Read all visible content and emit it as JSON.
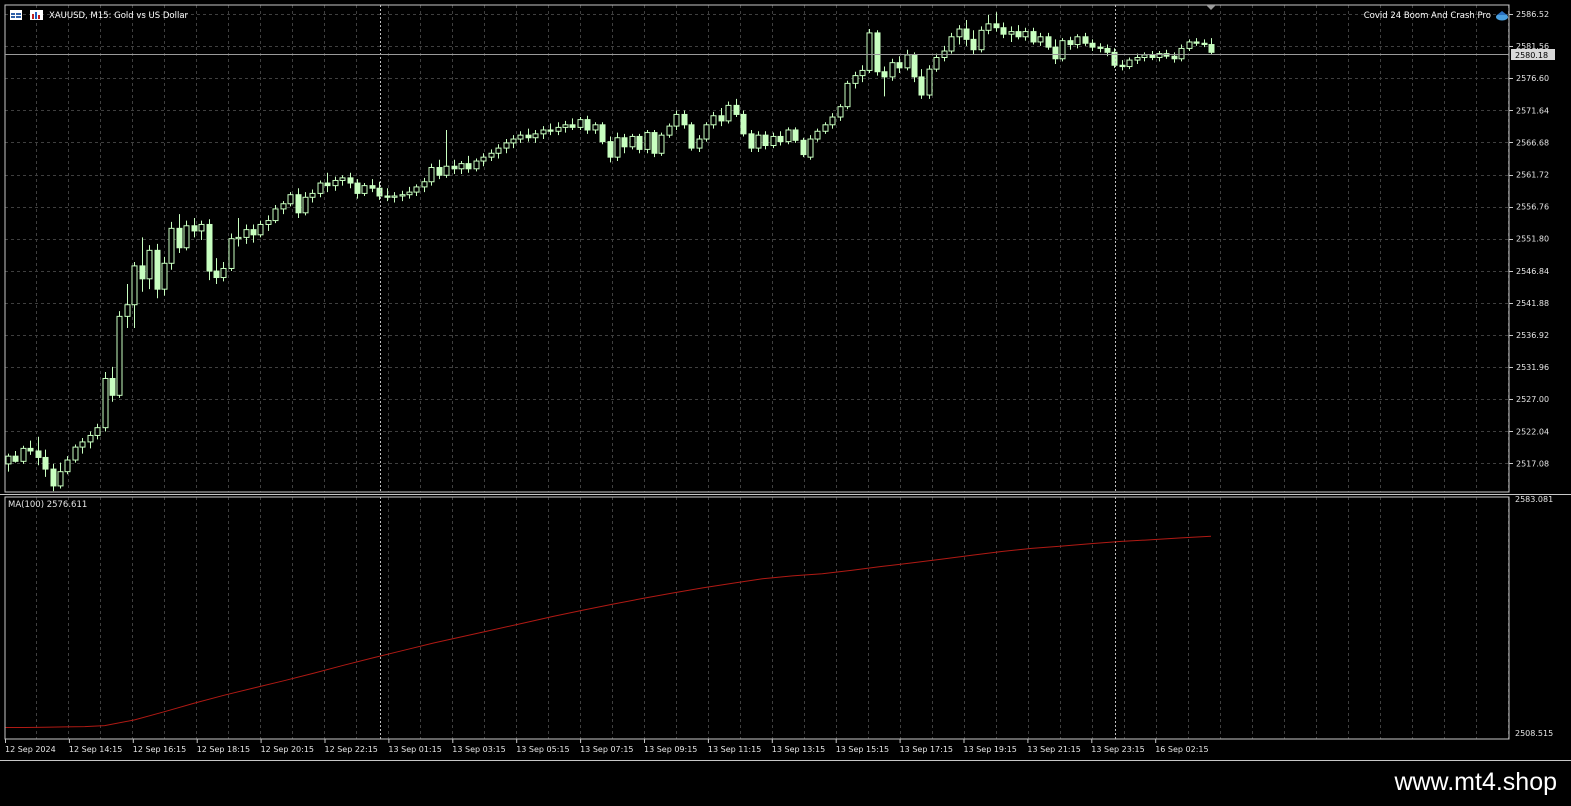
{
  "header": {
    "symbol_title": "XAUUSD, M15:  Gold vs US Dollar",
    "indicator_name": "Covid 24 Boom And Crash Pro",
    "icons": [
      "table-icon",
      "chart-icon",
      "hat-icon",
      "scroll-marker-icon"
    ]
  },
  "price_axis": {
    "labels": [
      "2586.52",
      "2581.56",
      "2576.60",
      "2571.64",
      "2566.68",
      "2561.72",
      "2556.76",
      "2551.80",
      "2546.84",
      "2541.88",
      "2536.92",
      "2531.96",
      "2527.00",
      "2522.04",
      "2517.08"
    ],
    "current_price": "2580.18"
  },
  "indicator_pane": {
    "label": "MA(100) 2576.611",
    "axis_top": "2583.081",
    "axis_bottom": "2508.515"
  },
  "time_axis": {
    "labels": [
      "12 Sep 2024",
      "12 Sep 14:15",
      "12 Sep 16:15",
      "12 Sep 18:15",
      "12 Sep 20:15",
      "12 Sep 22:15",
      "13 Sep 01:15",
      "13 Sep 03:15",
      "13 Sep 05:15",
      "13 Sep 07:15",
      "13 Sep 09:15",
      "13 Sep 11:15",
      "13 Sep 13:15",
      "13 Sep 15:15",
      "13 Sep 17:15",
      "13 Sep 19:15",
      "13 Sep 21:15",
      "13 Sep 23:15",
      "16 Sep 02:15"
    ]
  },
  "colors": {
    "background": "#000000",
    "grid": "#3f3f3f",
    "candle": "#c8ffc0",
    "ma_line": "#b01a14",
    "axis_text": "#e6e6e6"
  },
  "chart_data": {
    "type": "candlestick",
    "timeframe": "M15",
    "price_range": [
      2513.0,
      2588.0
    ],
    "candles": [
      [
        2517.0,
        2518.6,
        2515.8,
        2518.2
      ],
      [
        2518.2,
        2519.0,
        2517.2,
        2517.4
      ],
      [
        2517.4,
        2519.8,
        2517.0,
        2519.4
      ],
      [
        2519.4,
        2520.6,
        2518.4,
        2519.0
      ],
      [
        2519.0,
        2521.2,
        2516.8,
        2518.0
      ],
      [
        2518.0,
        2519.2,
        2515.0,
        2516.2
      ],
      [
        2516.2,
        2517.0,
        2512.8,
        2513.6
      ],
      [
        2513.6,
        2517.2,
        2513.2,
        2515.8
      ],
      [
        2515.8,
        2518.2,
        2515.4,
        2517.6
      ],
      [
        2517.6,
        2520.0,
        2517.2,
        2519.6
      ],
      [
        2519.6,
        2521.0,
        2518.6,
        2520.4
      ],
      [
        2520.4,
        2522.0,
        2519.4,
        2521.4
      ],
      [
        2521.4,
        2523.2,
        2520.8,
        2522.6
      ],
      [
        2522.6,
        2531.2,
        2522.0,
        2530.2
      ],
      [
        2530.2,
        2532.0,
        2526.6,
        2527.6
      ],
      [
        2527.6,
        2540.6,
        2527.2,
        2539.8
      ],
      [
        2539.8,
        2544.8,
        2538.0,
        2541.6
      ],
      [
        2541.6,
        2548.2,
        2538.0,
        2547.6
      ],
      [
        2547.6,
        2552.0,
        2543.6,
        2545.6
      ],
      [
        2545.6,
        2550.8,
        2544.0,
        2550.0
      ],
      [
        2550.0,
        2551.0,
        2542.6,
        2544.0
      ],
      [
        2544.0,
        2549.0,
        2543.0,
        2548.0
      ],
      [
        2548.0,
        2554.4,
        2547.0,
        2553.4
      ],
      [
        2553.4,
        2555.6,
        2549.6,
        2550.4
      ],
      [
        2550.4,
        2554.6,
        2550.0,
        2553.8
      ],
      [
        2553.8,
        2555.0,
        2552.0,
        2553.0
      ],
      [
        2553.0,
        2554.6,
        2551.6,
        2554.0
      ],
      [
        2554.0,
        2554.8,
        2545.4,
        2546.8
      ],
      [
        2546.8,
        2548.8,
        2544.8,
        2545.8
      ],
      [
        2545.8,
        2548.2,
        2545.2,
        2547.2
      ],
      [
        2547.2,
        2552.6,
        2546.8,
        2551.8
      ],
      [
        2551.8,
        2555.0,
        2550.6,
        2552.0
      ],
      [
        2552.0,
        2554.0,
        2551.0,
        2553.2
      ],
      [
        2553.2,
        2554.0,
        2551.2,
        2552.4
      ],
      [
        2552.4,
        2554.6,
        2552.0,
        2554.0
      ],
      [
        2554.0,
        2555.4,
        2553.0,
        2554.6
      ],
      [
        2554.6,
        2557.0,
        2554.2,
        2556.4
      ],
      [
        2556.4,
        2557.6,
        2555.6,
        2557.2
      ],
      [
        2557.2,
        2559.0,
        2556.8,
        2558.6
      ],
      [
        2558.6,
        2559.6,
        2555.0,
        2555.8
      ],
      [
        2555.8,
        2559.0,
        2555.4,
        2558.2
      ],
      [
        2558.2,
        2559.4,
        2557.4,
        2558.8
      ],
      [
        2558.8,
        2560.8,
        2558.2,
        2560.4
      ],
      [
        2560.4,
        2562.0,
        2559.0,
        2560.0
      ],
      [
        2560.0,
        2561.4,
        2559.2,
        2560.8
      ],
      [
        2560.8,
        2561.6,
        2560.0,
        2561.2
      ],
      [
        2561.2,
        2562.0,
        2559.6,
        2560.4
      ],
      [
        2560.4,
        2561.0,
        2558.0,
        2558.8
      ],
      [
        2558.8,
        2560.4,
        2558.4,
        2560.0
      ],
      [
        2560.0,
        2561.0,
        2559.0,
        2559.6
      ],
      [
        2559.6,
        2560.6,
        2557.8,
        2558.4
      ],
      [
        2558.4,
        2559.6,
        2557.6,
        2558.2
      ],
      [
        2558.2,
        2559.0,
        2557.4,
        2558.4
      ],
      [
        2558.4,
        2559.2,
        2557.6,
        2558.6
      ],
      [
        2558.6,
        2559.8,
        2558.0,
        2559.0
      ],
      [
        2559.0,
        2560.2,
        2558.4,
        2559.8
      ],
      [
        2559.8,
        2561.2,
        2559.0,
        2560.6
      ],
      [
        2560.6,
        2563.4,
        2560.0,
        2562.8
      ],
      [
        2562.8,
        2564.0,
        2561.0,
        2561.6
      ],
      [
        2561.6,
        2568.6,
        2561.2,
        2563.0
      ],
      [
        2563.0,
        2564.0,
        2561.8,
        2562.6
      ],
      [
        2562.6,
        2563.8,
        2561.8,
        2563.4
      ],
      [
        2563.4,
        2564.6,
        2562.0,
        2562.6
      ],
      [
        2562.6,
        2564.2,
        2562.2,
        2563.8
      ],
      [
        2563.8,
        2565.0,
        2563.0,
        2564.4
      ],
      [
        2564.4,
        2565.6,
        2563.8,
        2565.0
      ],
      [
        2565.0,
        2566.4,
        2564.2,
        2565.8
      ],
      [
        2565.8,
        2567.2,
        2565.0,
        2566.6
      ],
      [
        2566.6,
        2567.8,
        2565.8,
        2567.2
      ],
      [
        2567.2,
        2568.4,
        2566.6,
        2567.8
      ],
      [
        2567.8,
        2568.8,
        2566.8,
        2567.4
      ],
      [
        2567.4,
        2568.6,
        2566.6,
        2568.0
      ],
      [
        2568.0,
        2569.2,
        2567.2,
        2568.6
      ],
      [
        2568.6,
        2569.6,
        2567.8,
        2568.4
      ],
      [
        2568.4,
        2569.8,
        2567.8,
        2569.0
      ],
      [
        2569.0,
        2570.0,
        2568.2,
        2569.4
      ],
      [
        2569.4,
        2570.4,
        2568.6,
        2569.0
      ],
      [
        2569.0,
        2570.6,
        2568.6,
        2570.2
      ],
      [
        2570.2,
        2570.8,
        2568.0,
        2568.6
      ],
      [
        2568.6,
        2569.8,
        2568.0,
        2569.4
      ],
      [
        2569.4,
        2569.8,
        2566.4,
        2566.8
      ],
      [
        2566.8,
        2567.6,
        2563.6,
        2564.4
      ],
      [
        2564.4,
        2568.2,
        2563.8,
        2567.4
      ],
      [
        2567.4,
        2568.0,
        2565.0,
        2566.0
      ],
      [
        2566.0,
        2568.0,
        2565.6,
        2567.6
      ],
      [
        2567.6,
        2568.0,
        2565.0,
        2565.6
      ],
      [
        2565.6,
        2568.6,
        2565.0,
        2568.2
      ],
      [
        2568.2,
        2568.6,
        2564.4,
        2565.0
      ],
      [
        2565.0,
        2568.2,
        2564.6,
        2567.8
      ],
      [
        2567.8,
        2569.6,
        2567.4,
        2569.2
      ],
      [
        2569.2,
        2571.6,
        2568.6,
        2571.0
      ],
      [
        2571.0,
        2571.6,
        2568.8,
        2569.4
      ],
      [
        2569.4,
        2569.8,
        2565.4,
        2565.8
      ],
      [
        2565.8,
        2567.8,
        2565.2,
        2567.2
      ],
      [
        2567.2,
        2569.8,
        2566.8,
        2569.4
      ],
      [
        2569.4,
        2571.4,
        2568.8,
        2570.8
      ],
      [
        2570.8,
        2572.0,
        2569.2,
        2570.0
      ],
      [
        2570.0,
        2573.0,
        2569.6,
        2572.4
      ],
      [
        2572.4,
        2573.4,
        2570.6,
        2571.0
      ],
      [
        2571.0,
        2571.6,
        2567.6,
        2568.0
      ],
      [
        2568.0,
        2568.6,
        2565.2,
        2565.8
      ],
      [
        2565.8,
        2568.4,
        2565.2,
        2567.8
      ],
      [
        2567.8,
        2568.4,
        2565.6,
        2566.2
      ],
      [
        2566.2,
        2568.2,
        2565.8,
        2567.6
      ],
      [
        2567.6,
        2568.4,
        2566.2,
        2566.8
      ],
      [
        2566.8,
        2569.0,
        2566.4,
        2568.6
      ],
      [
        2568.6,
        2569.0,
        2566.6,
        2567.0
      ],
      [
        2567.0,
        2567.4,
        2564.4,
        2564.8
      ],
      [
        2564.4,
        2567.8,
        2564.0,
        2567.2
      ],
      [
        2567.2,
        2568.8,
        2566.8,
        2568.4
      ],
      [
        2568.4,
        2569.8,
        2568.0,
        2569.4
      ],
      [
        2569.4,
        2571.2,
        2568.8,
        2570.6
      ],
      [
        2570.6,
        2572.6,
        2570.0,
        2572.2
      ],
      [
        2572.2,
        2576.2,
        2571.8,
        2575.8
      ],
      [
        2575.8,
        2577.6,
        2575.0,
        2577.0
      ],
      [
        2577.0,
        2578.6,
        2576.0,
        2577.8
      ],
      [
        2577.8,
        2584.2,
        2577.4,
        2583.6
      ],
      [
        2583.6,
        2584.0,
        2577.0,
        2577.6
      ],
      [
        2577.6,
        2578.4,
        2573.8,
        2576.8
      ],
      [
        2576.8,
        2579.6,
        2576.2,
        2579.0
      ],
      [
        2579.0,
        2580.0,
        2577.4,
        2578.2
      ],
      [
        2578.2,
        2581.0,
        2577.8,
        2580.2
      ],
      [
        2580.2,
        2580.6,
        2576.0,
        2576.8
      ],
      [
        2576.8,
        2578.0,
        2573.4,
        2574.0
      ],
      [
        2574.0,
        2578.6,
        2573.4,
        2578.0
      ],
      [
        2578.0,
        2580.4,
        2577.6,
        2579.8
      ],
      [
        2579.8,
        2581.6,
        2579.2,
        2580.8
      ],
      [
        2580.8,
        2583.6,
        2580.4,
        2583.0
      ],
      [
        2583.0,
        2584.8,
        2581.8,
        2584.2
      ],
      [
        2584.2,
        2585.6,
        2581.6,
        2582.6
      ],
      [
        2582.6,
        2584.0,
        2580.2,
        2581.0
      ],
      [
        2581.0,
        2584.6,
        2580.6,
        2584.0
      ],
      [
        2584.0,
        2586.4,
        2583.4,
        2585.0
      ],
      [
        2585.0,
        2586.8,
        2583.8,
        2584.4
      ],
      [
        2584.4,
        2585.2,
        2582.8,
        2583.4
      ],
      [
        2583.4,
        2584.6,
        2582.2,
        2583.8
      ],
      [
        2583.8,
        2584.8,
        2582.6,
        2583.0
      ],
      [
        2583.0,
        2584.4,
        2582.4,
        2583.8
      ],
      [
        2583.8,
        2584.4,
        2581.8,
        2582.2
      ],
      [
        2582.2,
        2583.6,
        2581.6,
        2583.0
      ],
      [
        2583.0,
        2583.6,
        2581.0,
        2581.4
      ],
      [
        2581.4,
        2582.6,
        2578.8,
        2579.6
      ],
      [
        2579.6,
        2582.8,
        2579.2,
        2582.4
      ],
      [
        2582.4,
        2583.0,
        2581.0,
        2581.8
      ],
      [
        2581.8,
        2583.4,
        2581.2,
        2583.0
      ],
      [
        2583.0,
        2583.6,
        2581.6,
        2582.0
      ],
      [
        2582.0,
        2582.6,
        2580.8,
        2581.4
      ],
      [
        2581.4,
        2582.0,
        2580.6,
        2581.2
      ],
      [
        2581.2,
        2581.8,
        2580.0,
        2580.6
      ],
      [
        2580.6,
        2581.2,
        2578.2,
        2578.6
      ],
      [
        2578.6,
        2579.4,
        2577.8,
        2578.4
      ],
      [
        2578.4,
        2579.8,
        2578.0,
        2579.4
      ],
      [
        2579.4,
        2580.4,
        2578.8,
        2579.8
      ],
      [
        2579.8,
        2580.6,
        2579.2,
        2580.2
      ],
      [
        2580.2,
        2580.8,
        2579.4,
        2579.8
      ],
      [
        2579.8,
        2580.8,
        2579.2,
        2580.4
      ],
      [
        2580.4,
        2581.0,
        2579.6,
        2580.0
      ],
      [
        2580.0,
        2580.6,
        2579.0,
        2579.6
      ],
      [
        2579.6,
        2581.8,
        2579.2,
        2581.2
      ],
      [
        2581.2,
        2582.6,
        2580.8,
        2582.2
      ],
      [
        2582.2,
        2582.8,
        2581.6,
        2582.0
      ],
      [
        2582.0,
        2582.6,
        2581.4,
        2581.8
      ],
      [
        2581.8,
        2582.8,
        2580.2,
        2580.6
      ]
    ],
    "ma_period": 100,
    "ma_range": [
      2508.515,
      2583.081
    ],
    "ma_points": [
      [
        0,
        2511.2
      ],
      [
        20,
        2511.2
      ],
      [
        40,
        2511.3
      ],
      [
        60,
        2511.4
      ],
      [
        80,
        2511.5
      ],
      [
        100,
        2511.8
      ],
      [
        130,
        2513.6
      ],
      [
        160,
        2516.2
      ],
      [
        190,
        2518.9
      ],
      [
        220,
        2521.4
      ],
      [
        250,
        2523.7
      ],
      [
        280,
        2526.0
      ],
      [
        310,
        2528.4
      ],
      [
        340,
        2530.9
      ],
      [
        370,
        2533.3
      ],
      [
        400,
        2535.6
      ],
      [
        430,
        2537.9
      ],
      [
        460,
        2540.0
      ],
      [
        490,
        2542.1
      ],
      [
        520,
        2544.2
      ],
      [
        550,
        2546.3
      ],
      [
        580,
        2548.3
      ],
      [
        610,
        2550.2
      ],
      [
        640,
        2552.0
      ],
      [
        670,
        2553.7
      ],
      [
        700,
        2555.3
      ],
      [
        730,
        2556.8
      ],
      [
        760,
        2558.2
      ],
      [
        790,
        2559.1
      ],
      [
        820,
        2559.8
      ],
      [
        850,
        2560.9
      ],
      [
        880,
        2562.1
      ],
      [
        910,
        2563.2
      ],
      [
        940,
        2564.4
      ],
      [
        970,
        2565.6
      ],
      [
        1000,
        2566.8
      ],
      [
        1030,
        2567.8
      ],
      [
        1060,
        2568.5
      ],
      [
        1090,
        2569.3
      ],
      [
        1120,
        2570.0
      ],
      [
        1150,
        2570.5
      ],
      [
        1180,
        2571.1
      ],
      [
        1210,
        2571.6
      ]
    ]
  }
}
